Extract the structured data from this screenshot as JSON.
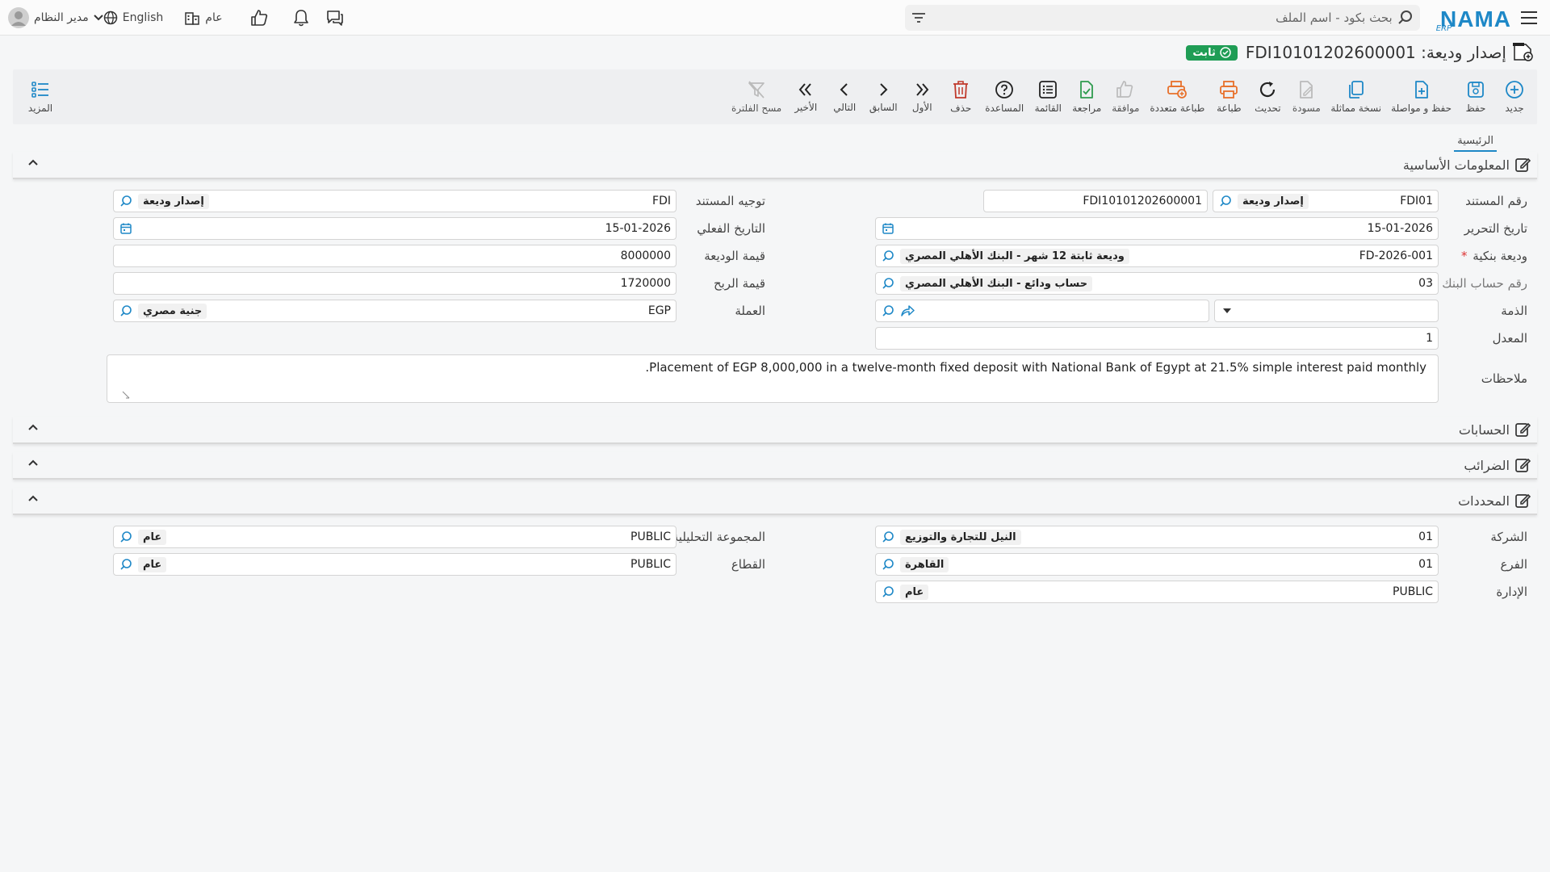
{
  "header": {
    "logo_text": "NAMA",
    "logo_sub": "ERP",
    "search_placeholder": "بحث بكود - اسم الملف",
    "user_name": "مدير النظام",
    "language": "English",
    "scope": "عام"
  },
  "page": {
    "title_prefix": "إصدار وديعة:",
    "doc_number": "FDI10101202600001",
    "status": "ثابت"
  },
  "toolbar": {
    "buttons": [
      {
        "id": "new",
        "label": "جديد",
        "color": "#1e88c7"
      },
      {
        "id": "save",
        "label": "حفظ",
        "color": "#1e88c7"
      },
      {
        "id": "save_continue",
        "label": "حفظ و مواصلة",
        "color": "#1e88c7"
      },
      {
        "id": "duplicate",
        "label": "نسخة مماثلة",
        "color": "#1e88c7"
      },
      {
        "id": "draft",
        "label": "مسودة",
        "color": "#bbbbbb"
      },
      {
        "id": "refresh",
        "label": "تحديث",
        "color": "#222222"
      },
      {
        "id": "print",
        "label": "طباعة",
        "color": "#e8702a"
      },
      {
        "id": "multi_print",
        "label": "طباعة متعددة",
        "color": "#e8702a"
      },
      {
        "id": "approve",
        "label": "موافقة",
        "color": "#bbbbbb"
      },
      {
        "id": "review",
        "label": "مراجعة",
        "color": "#2e9b4e"
      },
      {
        "id": "list",
        "label": "القائمة",
        "color": "#222222"
      },
      {
        "id": "help",
        "label": "المساعدة",
        "color": "#222222"
      },
      {
        "id": "delete",
        "label": "حذف",
        "color": "#c0392b"
      },
      {
        "id": "first",
        "label": "الأول",
        "color": "#222222"
      },
      {
        "id": "prev",
        "label": "السابق",
        "color": "#222222"
      },
      {
        "id": "next",
        "label": "التالي",
        "color": "#222222"
      },
      {
        "id": "last",
        "label": "الأخير",
        "color": "#222222"
      },
      {
        "id": "clear_filter",
        "label": "مسح الفلترة",
        "color": "#bbbbbb"
      }
    ],
    "more_label": "المزيد"
  },
  "tabs": [
    {
      "label": "الرئيسية"
    }
  ],
  "sections": {
    "basic_info": "المعلومات الأساسية",
    "accounts": "الحسابات",
    "taxes": "الضرائب",
    "dimensions": "المحددات"
  },
  "basic": {
    "doc_number": {
      "label": "رقم المستند",
      "code": "FDI01",
      "desc": "إصدار وديعة",
      "number": "FDI10101202600001"
    },
    "doc_direction": {
      "label": "توجيه المستند",
      "code": "FDI",
      "desc": "إصدار وديعة"
    },
    "edit_date": {
      "label": "تاريخ التحرير",
      "value": "15-01-2026"
    },
    "actual_date": {
      "label": "التاريخ الفعلي",
      "value": "15-01-2026"
    },
    "bank_deposit": {
      "label": "وديعة بنكية",
      "code": "FD-2026-001",
      "desc": "وديعة ثابتة 12 شهر - البنك الأهلي المصري",
      "required": "*"
    },
    "deposit_value": {
      "label": "قيمة الوديعة",
      "value": "8000000"
    },
    "bank_account": {
      "label": "رقم حساب البنك",
      "code": "03",
      "desc": "حساب ودائع - البنك الأهلي المصري"
    },
    "profit_value": {
      "label": "قيمة الربح",
      "value": "1720000"
    },
    "liability": {
      "label": "الذمة"
    },
    "currency": {
      "label": "العملة",
      "code": "EGP",
      "desc": "جنية مصري"
    },
    "rate": {
      "label": "المعدل",
      "value": "1"
    },
    "notes": {
      "label": "ملاحظات",
      "value": "Placement of EGP 8,000,000 in a twelve-month fixed deposit with National Bank of Egypt at 21.5% simple interest paid monthly."
    }
  },
  "dims": {
    "company": {
      "label": "الشركة",
      "code": "01",
      "desc": "النيل للتجارة والتوزيع"
    },
    "analytic_group": {
      "label": "المجموعة التحليلية",
      "code": "PUBLIC",
      "desc": "عام"
    },
    "branch": {
      "label": "الفرع",
      "code": "01",
      "desc": "القاهرة"
    },
    "sector": {
      "label": "القطاع",
      "code": "PUBLIC",
      "desc": "عام"
    },
    "department": {
      "label": "الإدارة",
      "code": "PUBLIC",
      "desc": "عام"
    }
  }
}
